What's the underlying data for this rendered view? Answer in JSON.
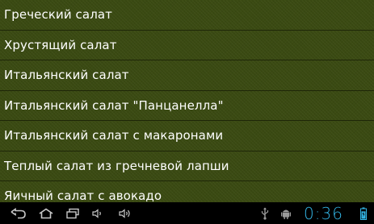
{
  "salad_list": {
    "items": [
      {
        "label": "Греческий салат"
      },
      {
        "label": "Хрустящий салат"
      },
      {
        "label": "Итальянский салат"
      },
      {
        "label": "Итальянский салат \"Панцанелла\""
      },
      {
        "label": "Итальянский салат с макаронами"
      },
      {
        "label": "Теплый салат из гречневой лапши"
      },
      {
        "label": "Яичный салат с авокадо"
      }
    ]
  },
  "system_bar": {
    "icons": [
      "back-icon",
      "home-icon",
      "recent-apps-icon",
      "volume-down-icon",
      "volume-up-icon",
      "usb-icon",
      "android-debug-icon",
      "battery-icon"
    ],
    "clock": "0:36",
    "accent_color": "#33b5e5",
    "battery_level": 0.8
  },
  "colors": {
    "list_background": "#3a4a12",
    "divider": "#1e2608",
    "text": "#ffffff"
  }
}
